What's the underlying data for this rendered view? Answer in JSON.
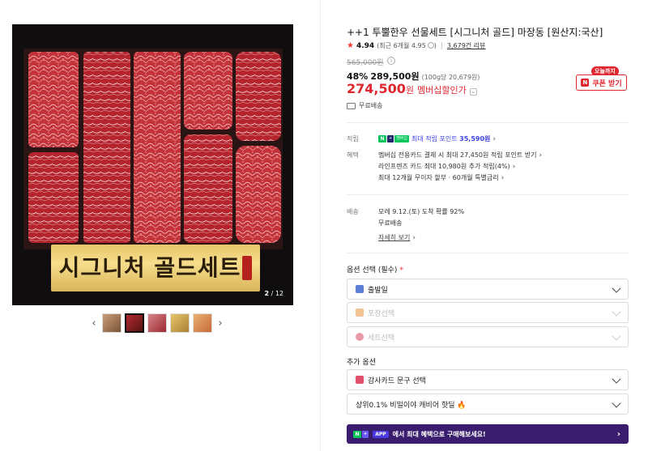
{
  "gallery": {
    "overlay_text": "시그니처 골드세트",
    "counter_current": "2",
    "counter_total": "12",
    "thumb_count": 5,
    "active_thumb_index": 1
  },
  "product": {
    "title": "++1 투뿔한우 선물세트 [시그니처 골드] 마장동 [원산지:국산]",
    "rating": "4.94",
    "rating_recent": "(최근 6개월 4.95",
    "review_count": "3,679건 리뷰",
    "original_price": "565,000원",
    "discount_pct": "48%",
    "discount_price": "289,500원",
    "unit_price": "(100g당 20,679원)",
    "final_price": "274,500",
    "final_won": "원",
    "member_discount": "멤버십할인가",
    "coupon_tag": "오늘까지",
    "coupon_button": "쿠폰 받기",
    "free_shipping": "무료배송"
  },
  "benefits": {
    "points_label": "적립",
    "points_text": "최대 적립 포인트",
    "points_value": "35,590원",
    "benefit_label": "혜택",
    "benefit_lines": [
      "멤버십 전용카드 결제 시 최대 27,450원 적립 포인트 받기",
      "라인프렌즈 카드 최대 10,980원 추가 적립(4%)",
      "최대 12개월 무이자 할부 · 60개월 특별금리"
    ]
  },
  "shipping": {
    "label": "배송",
    "arrival": "모레 9.12.(토) 도착 확률 92%",
    "fee": "무료배송",
    "detail_link": "자세히 보기"
  },
  "options": {
    "title": "옵션 선택 (필수)",
    "required_mark": "*",
    "selects": [
      {
        "label": "출발일",
        "disabled": false,
        "icon_color": "#5b7fd8"
      },
      {
        "label": "포장선택",
        "disabled": true,
        "icon_color": "#e89a4a"
      },
      {
        "label": "세트선택",
        "disabled": true,
        "icon_color": "#d8556a"
      }
    ],
    "extra_title": "추가 옵션",
    "extra_selects": [
      {
        "label": "감사카드 문구 선택",
        "icon_color": "#e0506a"
      },
      {
        "label": "상위0.1% 비밀이야 캐비어 핫딜 🔥",
        "icon_color": null
      }
    ]
  },
  "banner": {
    "badge": "APP",
    "text": "에서 최대 혜택으로 구매해보세요!"
  },
  "colors": {
    "accent_red": "#e0262e",
    "point_blue": "#3d3fe0",
    "naver_green": "#03c75a",
    "banner_purple": "#3a1d6e"
  }
}
